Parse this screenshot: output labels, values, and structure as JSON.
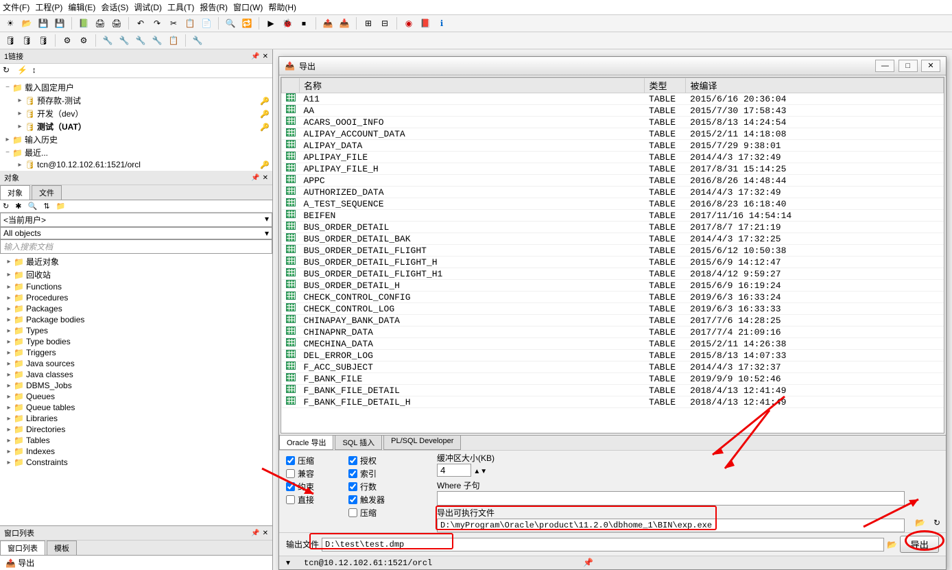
{
  "menu": {
    "file": "文件(F)",
    "project": "工程(P)",
    "edit": "编辑(E)",
    "session": "会话(S)",
    "debug": "调试(D)",
    "tools": "工具(T)",
    "report": "报告(R)",
    "window": "窗口(W)",
    "help": "帮助(H)"
  },
  "panels": {
    "conn_title": "1链接",
    "obj_title": "对象",
    "obj_tab": "对象",
    "file_tab": "文件",
    "current_user": "<当前用户>",
    "all_objects": "All objects",
    "search_placeholder": "输入搜索文档",
    "window_list": "窗口列表",
    "template": "模板",
    "export_item": "导出"
  },
  "conn_tree": [
    {
      "label": "载入固定用户",
      "icon": "folder",
      "indent": 0,
      "exp": "−"
    },
    {
      "label": "预存款-测试",
      "icon": "db",
      "indent": 1,
      "key": true
    },
    {
      "label": "开发（dev）",
      "icon": "db",
      "indent": 1,
      "key": true
    },
    {
      "label": "测试（UAT）",
      "icon": "db",
      "indent": 1,
      "key": true,
      "bold": true
    },
    {
      "label": "输入历史",
      "icon": "folder",
      "indent": 0
    },
    {
      "label": "最近...",
      "icon": "folder",
      "indent": 0,
      "exp": "−"
    },
    {
      "label": "tcn@10.12.102.61:1521/orcl",
      "icon": "db",
      "indent": 1,
      "key": true
    }
  ],
  "obj_tree": [
    "最近对象",
    "回收站",
    "Functions",
    "Procedures",
    "Packages",
    "Package bodies",
    "Types",
    "Type bodies",
    "Triggers",
    "Java sources",
    "Java classes",
    "DBMS_Jobs",
    "Queues",
    "Queue tables",
    "Libraries",
    "Directories",
    "Tables",
    "Indexes",
    "Constraints"
  ],
  "dialog": {
    "title": "导出",
    "cols": {
      "name": "名称",
      "type": "类型",
      "compiled": "被编译"
    },
    "rows": [
      {
        "n": "A11",
        "t": "TABLE",
        "c": "2015/6/16 20:36:04"
      },
      {
        "n": "AA",
        "t": "TABLE",
        "c": "2015/7/30 17:58:43"
      },
      {
        "n": "ACARS_OOOI_INFO",
        "t": "TABLE",
        "c": "2015/8/13 14:24:54"
      },
      {
        "n": "ALIPAY_ACCOUNT_DATA",
        "t": "TABLE",
        "c": "2015/2/11 14:18:08"
      },
      {
        "n": "ALIPAY_DATA",
        "t": "TABLE",
        "c": "2015/7/29 9:38:01"
      },
      {
        "n": "APLIPAY_FILE",
        "t": "TABLE",
        "c": "2014/4/3 17:32:49"
      },
      {
        "n": "APLIPAY_FILE_H",
        "t": "TABLE",
        "c": "2017/8/31 15:14:25"
      },
      {
        "n": "APPC",
        "t": "TABLE",
        "c": "2016/8/26 14:48:44"
      },
      {
        "n": "AUTHORIZED_DATA",
        "t": "TABLE",
        "c": "2014/4/3 17:32:49"
      },
      {
        "n": "A_TEST_SEQUENCE",
        "t": "TABLE",
        "c": "2016/8/23 16:18:40"
      },
      {
        "n": "BEIFEN",
        "t": "TABLE",
        "c": "2017/11/16 14:54:14"
      },
      {
        "n": "BUS_ORDER_DETAIL",
        "t": "TABLE",
        "c": "2017/8/7 17:21:19"
      },
      {
        "n": "BUS_ORDER_DETAIL_BAK",
        "t": "TABLE",
        "c": "2014/4/3 17:32:25"
      },
      {
        "n": "BUS_ORDER_DETAIL_FLIGHT",
        "t": "TABLE",
        "c": "2015/6/12 10:50:38"
      },
      {
        "n": "BUS_ORDER_DETAIL_FLIGHT_H",
        "t": "TABLE",
        "c": "2015/6/9 14:12:47"
      },
      {
        "n": "BUS_ORDER_DETAIL_FLIGHT_H1",
        "t": "TABLE",
        "c": "2018/4/12 9:59:27"
      },
      {
        "n": "BUS_ORDER_DETAIL_H",
        "t": "TABLE",
        "c": "2015/6/9 16:19:24"
      },
      {
        "n": "CHECK_CONTROL_CONFIG",
        "t": "TABLE",
        "c": "2019/6/3 16:33:24"
      },
      {
        "n": "CHECK_CONTROL_LOG",
        "t": "TABLE",
        "c": "2019/6/3 16:33:33"
      },
      {
        "n": "CHINAPAY_BANK_DATA",
        "t": "TABLE",
        "c": "2017/7/6 14:28:25"
      },
      {
        "n": "CHINAPNR_DATA",
        "t": "TABLE",
        "c": "2017/7/4 21:09:16"
      },
      {
        "n": "CMECHINA_DATA",
        "t": "TABLE",
        "c": "2015/2/11 14:26:38"
      },
      {
        "n": "DEL_ERROR_LOG",
        "t": "TABLE",
        "c": "2015/8/13 14:07:33"
      },
      {
        "n": "F_ACC_SUBJECT",
        "t": "TABLE",
        "c": "2014/4/3 17:32:37"
      },
      {
        "n": "F_BANK_FILE",
        "t": "TABLE",
        "c": "2019/9/9 10:52:46"
      },
      {
        "n": "F_BANK_FILE_DETAIL",
        "t": "TABLE",
        "c": "2018/4/13 12:41:49"
      },
      {
        "n": "F_BANK_FILE_DETAIL_H",
        "t": "TABLE",
        "c": "2018/4/13 12:41:49"
      }
    ],
    "tabs": {
      "oracle": "Oracle 导出",
      "sql": "SQL 插入",
      "plsql": "PL/SQL Developer"
    },
    "opts": {
      "compress": "压缩",
      "compat": "兼容",
      "constraint": "约束",
      "direct": "直接",
      "grant": "授权",
      "index": "索引",
      "rows": "行数",
      "trigger": "触发器",
      "compress2": "压缩"
    },
    "buffer_label": "缓冲区大小(KB)",
    "buffer_val": "4",
    "where_label": "Where 子句",
    "where_val": "",
    "exe_label": "导出可执行文件",
    "exe_val": "D:\\myProgram\\Oracle\\product\\11.2.0\\dbhome_1\\BIN\\exp.exe",
    "output_label": "输出文件",
    "output_val": "D:\\test\\test.dmp",
    "export_btn": "导出",
    "status": "tcn@10.12.102.61:1521/orcl"
  }
}
